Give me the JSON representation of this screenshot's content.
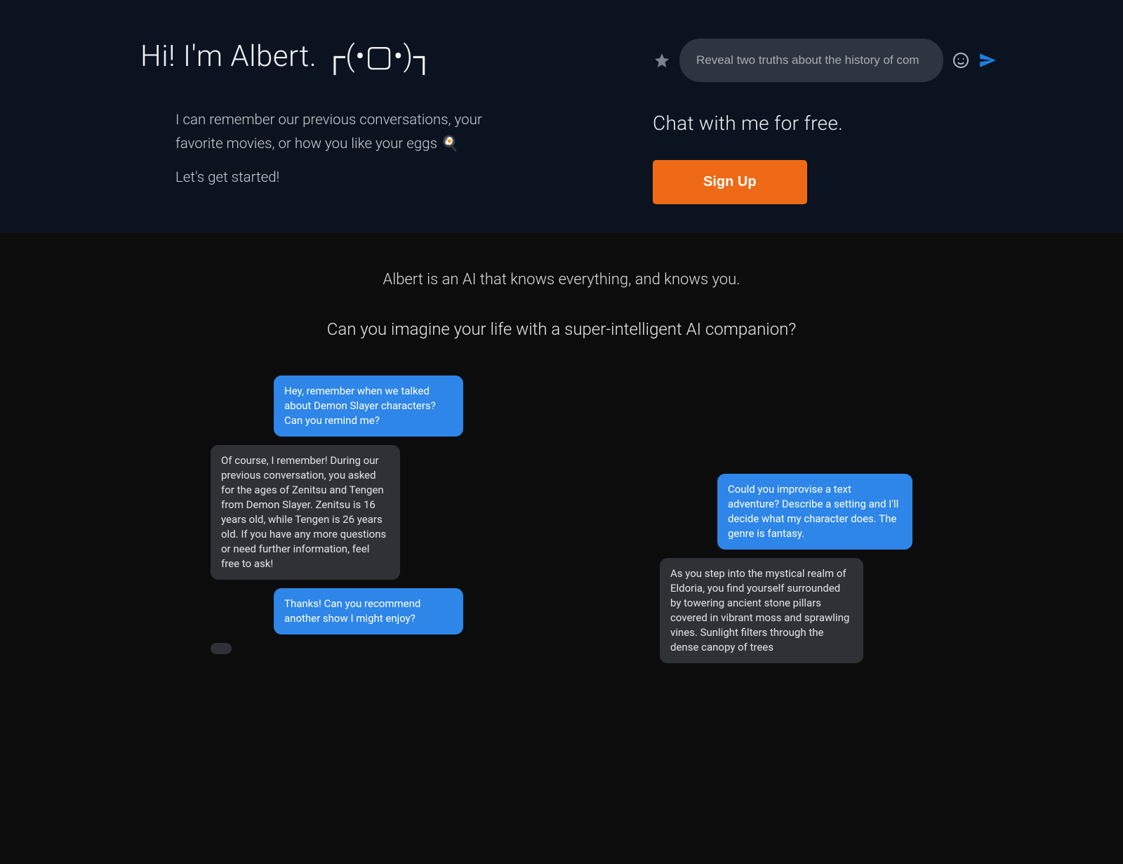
{
  "hero": {
    "title": "Hi! I'm Albert.  ┌(•▢•)┐",
    "desc_p1": "I can remember our previous conversations, your favorite movies, or how you like your eggs 🍳",
    "desc_p2": "Let's get started!"
  },
  "chat_input": {
    "value": "Reveal two truths about the history of com"
  },
  "cta": {
    "heading": "Chat with me for free.",
    "signup_label": "Sign Up"
  },
  "section2": {
    "line1": "Albert is an AI that knows everything, and knows you.",
    "line2": "Can you imagine your life with a super-intelligent AI companion?"
  },
  "conv1": [
    {
      "role": "user",
      "text": "Hey, remember when we talked about Demon Slayer characters? Can you remind me?"
    },
    {
      "role": "ai",
      "text": "Of course, I remember! During our previous conversation, you asked for the ages of Zenitsu and Tengen from Demon Slayer. Zenitsu is 16 years old, while Tengen is 26 years old. If you have any more questions or need further information, feel free to ask!"
    },
    {
      "role": "user",
      "text": "Thanks! Can you recommend another show I might enjoy?"
    }
  ],
  "conv2": [
    {
      "role": "user",
      "text": "Could you improvise a text adventure? Describe a setting and I'll decide what my character does. The genre is fantasy."
    },
    {
      "role": "ai",
      "text": "As you step into the mystical realm of Eldoria, you find yourself surrounded by towering ancient stone pillars covered in vibrant moss and sprawling vines. Sunlight filters through the dense canopy of trees"
    }
  ]
}
